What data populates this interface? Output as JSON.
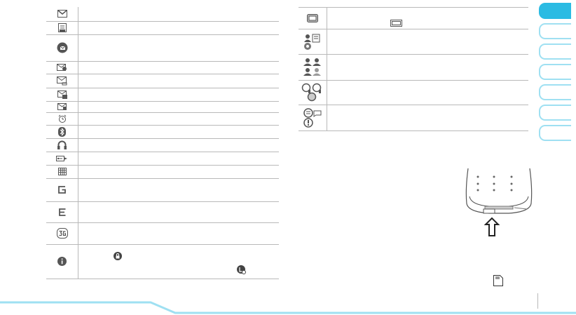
{
  "left_icons": [
    {
      "icon": "envelope-icon",
      "height": 20
    },
    {
      "icon": "message-box-icon",
      "height": 19
    },
    {
      "icon": "new-email-icon",
      "height": 38
    },
    {
      "icon": "voicemail-icon",
      "height": 18
    },
    {
      "icon": "mms-icon",
      "height": 20
    },
    {
      "icon": "push-message-icon",
      "height": 19
    },
    {
      "icon": "inbox-full-icon",
      "height": 16
    },
    {
      "icon": "alarm-icon",
      "height": 18
    },
    {
      "icon": "bluetooth-icon",
      "height": 19
    },
    {
      "icon": "headset-icon",
      "height": 19
    },
    {
      "icon": "usb-icon",
      "height": 19
    },
    {
      "icon": "calendar-icon",
      "height": 19
    },
    {
      "icon": "gprs-icon",
      "height": 33
    },
    {
      "icon": "edge-icon",
      "height": 30
    },
    {
      "icon": "3g-icon",
      "height": 31
    },
    {
      "icon": "info-icon",
      "height": 49
    }
  ],
  "right_icons": [
    {
      "icon": "battery-icon",
      "height": 31
    },
    {
      "icon": "contact-card-icon",
      "height": 36
    },
    {
      "icon": "contacts-group-icon",
      "height": 37
    },
    {
      "icon": "chat-icon",
      "height": 35
    },
    {
      "icon": "speech-bubble-icon",
      "height": 37
    }
  ],
  "tabs_count": 7,
  "colors": {
    "accent": "#2bbbe3",
    "accent_light": "#9fe0f2",
    "rule": "#b9b9b9",
    "icon": "#555555"
  }
}
